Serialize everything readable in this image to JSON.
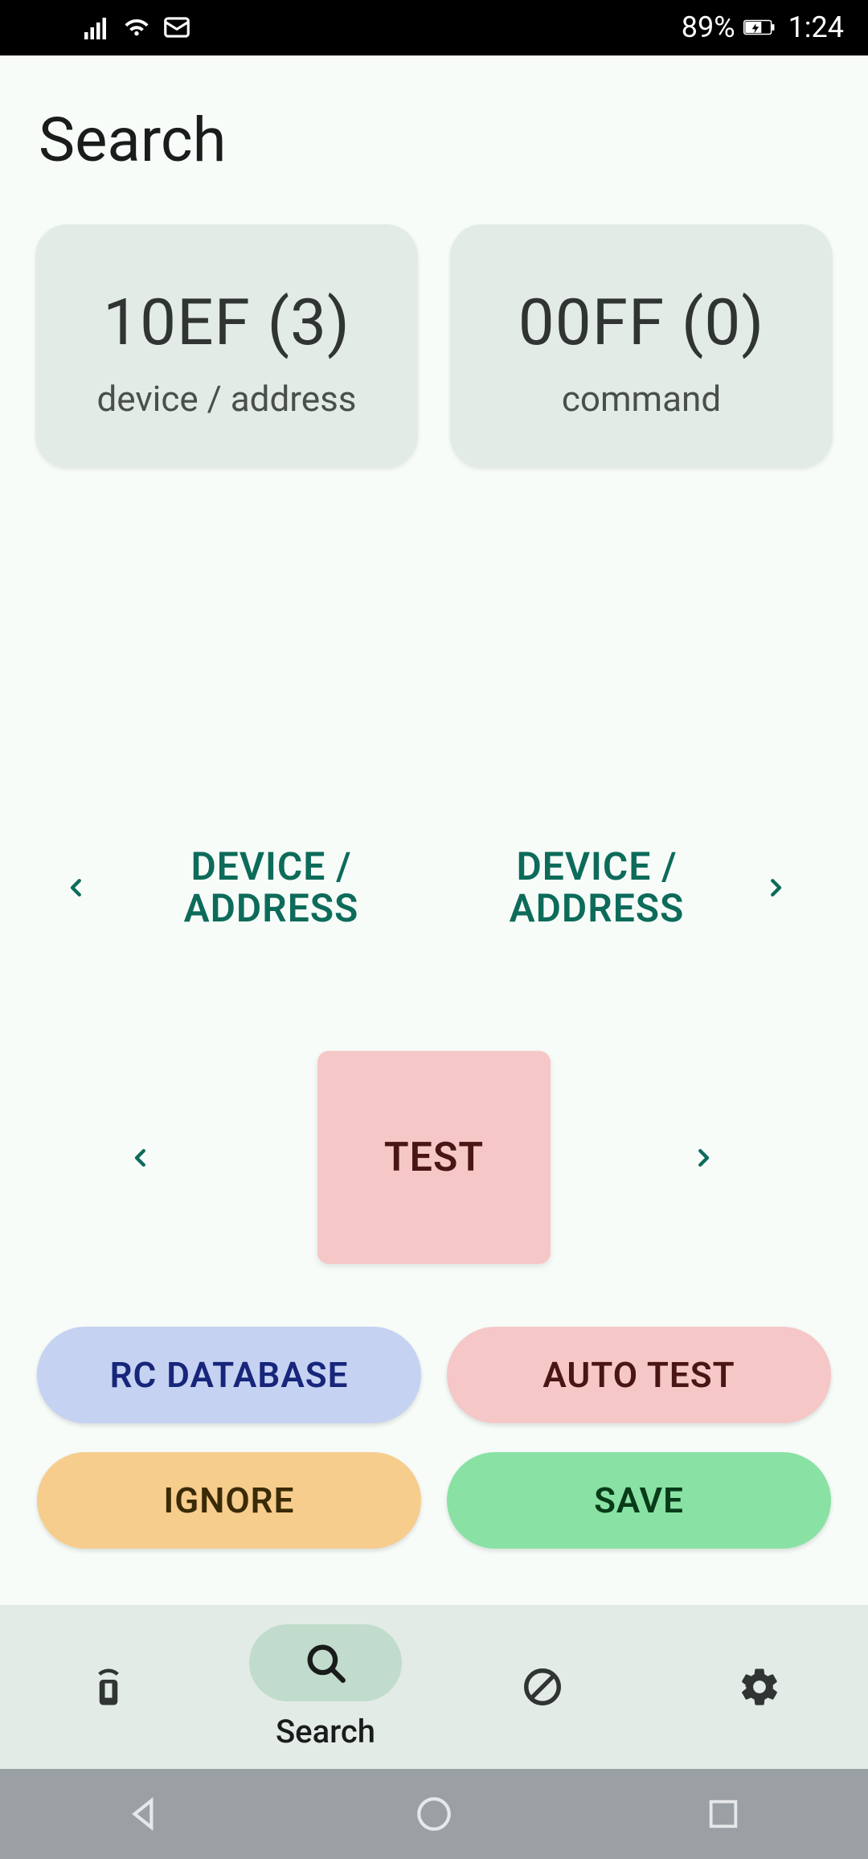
{
  "status_bar": {
    "battery_percent": "89%",
    "time": "1:24"
  },
  "header": {
    "title": "Search"
  },
  "cards": {
    "device": {
      "value": "10EF (3)",
      "sub": "device / address"
    },
    "command": {
      "value": "00FF (0)",
      "sub": "command"
    }
  },
  "stepper": {
    "label_left": "DEVICE / ADDRESS",
    "label_right": "DEVICE / ADDRESS"
  },
  "test": {
    "label": "TEST"
  },
  "actions": {
    "rc_database": "RC DATABASE",
    "auto_test": "AUTO TEST",
    "ignore": "IGNORE",
    "save": "SAVE"
  },
  "bottom_nav": {
    "search_label": "Search"
  },
  "colors": {
    "accent_teal": "#0d6b5a",
    "card_bg": "#e3ebe6",
    "test_bg": "#f6c7c7",
    "rc_bg": "#c6d2f2",
    "auto_bg": "#f6c7c7",
    "ignore_bg": "#f7cd8e",
    "save_bg": "#89e2a4"
  }
}
